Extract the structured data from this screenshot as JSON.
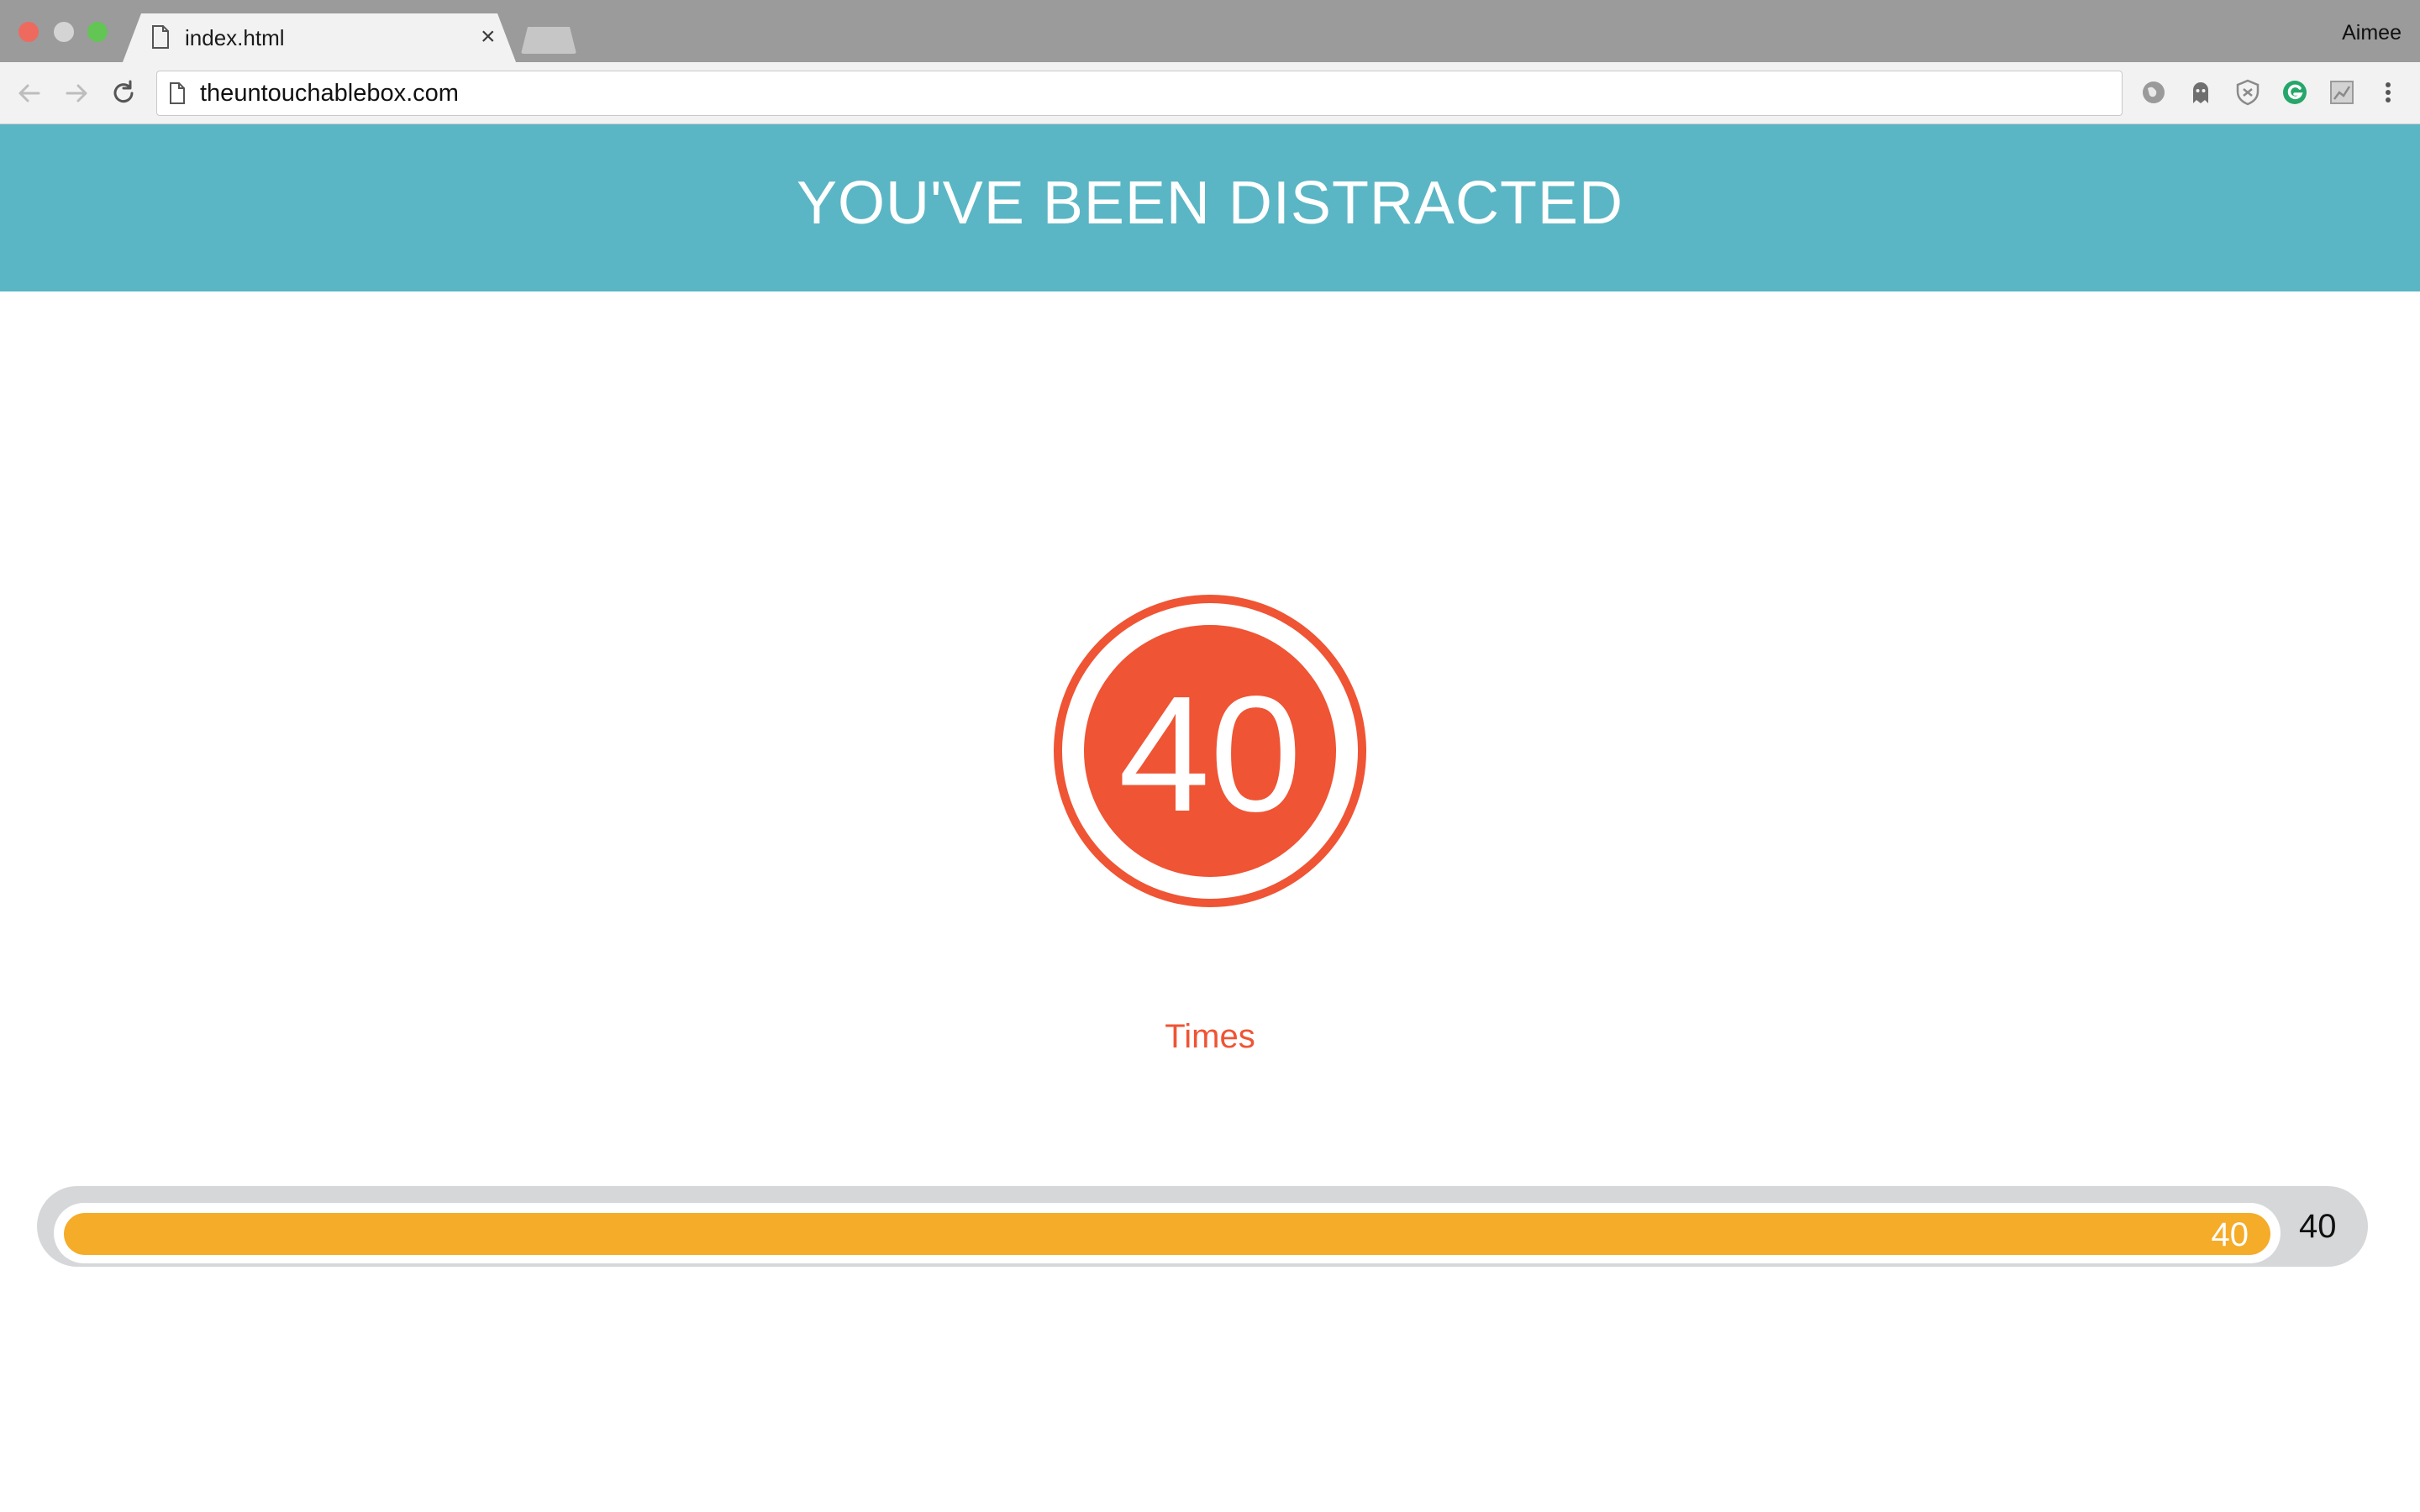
{
  "browser": {
    "tab": {
      "title": "index.html",
      "close_glyph": "×"
    },
    "profile_name": "Aimee",
    "address_bar": {
      "url": "theuntouchablebox.com"
    },
    "extensions": [
      "globe-icon",
      "ghost-icon",
      "shield-icon",
      "grammarly-icon",
      "chart-icon"
    ]
  },
  "page": {
    "banner_title": "YOU'VE BEEN DISTRACTED",
    "counter": {
      "value": "40",
      "label": "Times"
    },
    "progress": {
      "value": 40,
      "fraction": 1.0,
      "fill_label": "40",
      "end_label": "40"
    }
  },
  "colors": {
    "banner": "#5ab6c4",
    "accent_red": "#ef5434",
    "progress_fill": "#f5ac29",
    "progress_track": "#d6d7d9"
  }
}
